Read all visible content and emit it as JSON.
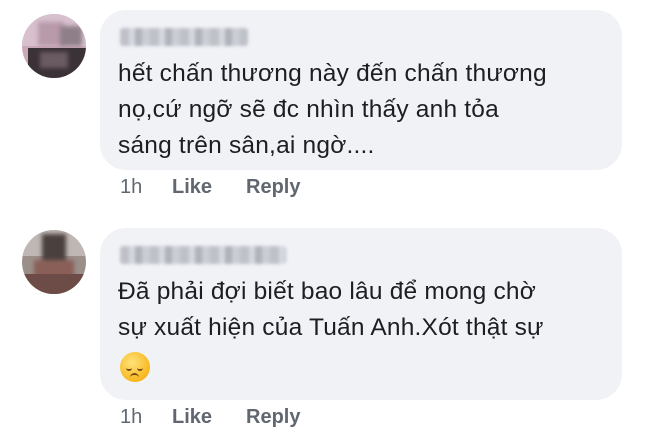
{
  "comments": [
    {
      "text_lines": [
        "hết chấn thương này đến chấn thương",
        "nọ,cứ ngỡ sẽ đc nhìn thấy anh tỏa",
        "sáng trên sân,ai ngờ...."
      ],
      "time": "1h",
      "like_label": "Like",
      "reply_label": "Reply"
    },
    {
      "text_lines": [
        "Đã phải đợi biết bao lâu để mong chờ",
        "sự xuất hiện của Tuấn Anh.Xót thật sự"
      ],
      "reaction_emoji": "pensive-face-emoji",
      "time": "1h",
      "like_label": "Like",
      "reply_label": "Reply"
    }
  ]
}
